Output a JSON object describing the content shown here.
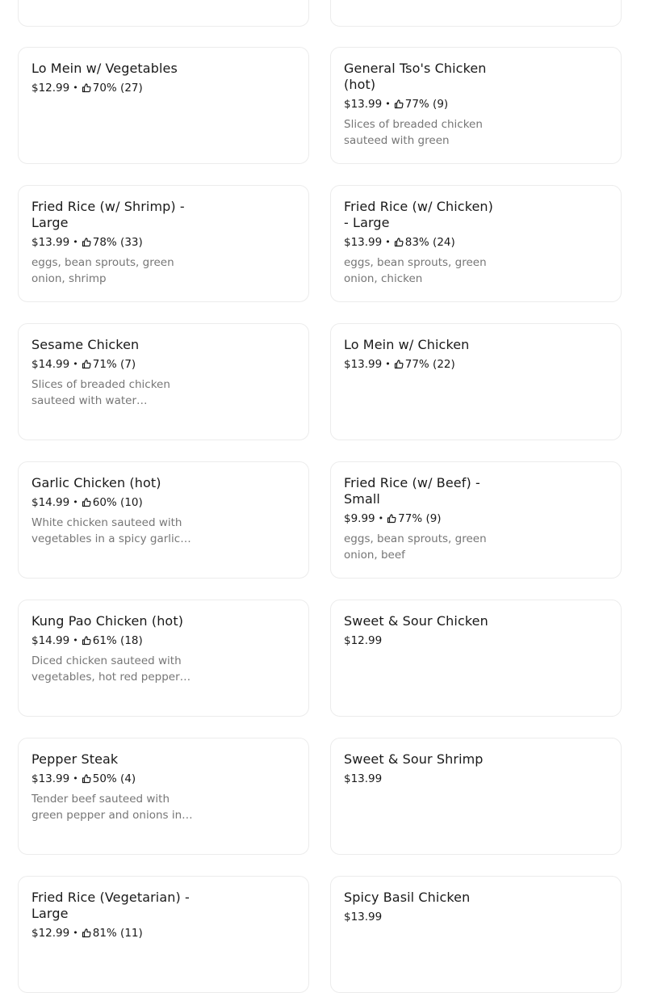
{
  "menu": {
    "items": [
      {
        "name": "Lo Mein w/ Vegetables",
        "price": "$12.99",
        "rating": "70% (27)",
        "description": ""
      },
      {
        "name": "General Tso's Chicken (hot)",
        "price": "$13.99",
        "rating": "77% (9)",
        "description": "Slices of breaded chicken sauteed with green pepper,…"
      },
      {
        "name": "Fried Rice (w/ Shrimp) - Large",
        "price": "$13.99",
        "rating": "78% (33)",
        "description": "eggs, bean sprouts, green onion, shrimp"
      },
      {
        "name": "Fried Rice (w/ Chicken) - Large",
        "price": "$13.99",
        "rating": "83% (24)",
        "description": "eggs, bean sprouts, green onion, chicken"
      },
      {
        "name": "Sesame Chicken",
        "price": "$14.99",
        "rating": "71% (7)",
        "description": "Slices of breaded chicken sauteed with water…"
      },
      {
        "name": "Lo Mein w/ Chicken",
        "price": "$13.99",
        "rating": "77% (22)",
        "description": ""
      },
      {
        "name": "Garlic Chicken (hot)",
        "price": "$14.99",
        "rating": "60% (10)",
        "description": "White chicken sauteed with vegetables in a spicy garlic…"
      },
      {
        "name": "Fried Rice (w/ Beef) - Small",
        "price": "$9.99",
        "rating": "77% (9)",
        "description": "eggs, bean sprouts, green onion, beef"
      },
      {
        "name": "Kung Pao Chicken (hot)",
        "price": "$14.99",
        "rating": "61% (18)",
        "description": "Diced chicken sauteed with vegetables, hot red pepper…"
      },
      {
        "name": "Sweet & Sour Chicken",
        "price": "$12.99",
        "rating": "",
        "description": ""
      },
      {
        "name": "Pepper Steak",
        "price": "$13.99",
        "rating": "50% (4)",
        "description": "Tender beef sauteed with green pepper and onions in…"
      },
      {
        "name": "Sweet & Sour Shrimp",
        "price": "$13.99",
        "rating": "",
        "description": ""
      },
      {
        "name": "Fried Rice (Vegetarian) - Large",
        "price": "$12.99",
        "rating": "81% (11)",
        "description": ""
      },
      {
        "name": "Spicy Basil Chicken",
        "price": "$13.99",
        "rating": "",
        "description": ""
      }
    ],
    "separator": "•",
    "rating_icon": "thumbs-up-icon"
  }
}
